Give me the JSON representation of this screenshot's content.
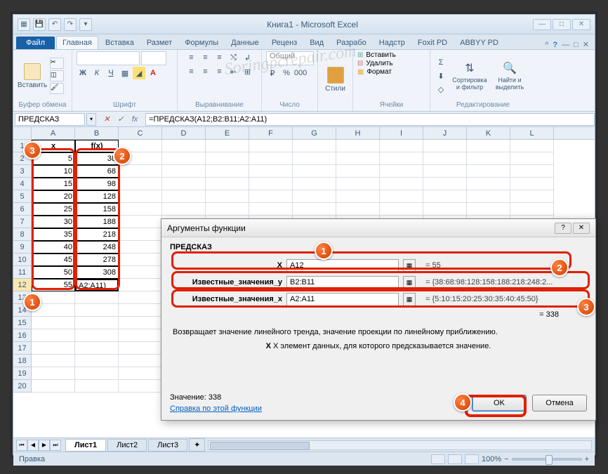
{
  "window": {
    "title": "Книга1 - Microsoft Excel"
  },
  "ribbon": {
    "file": "Файл",
    "tabs": [
      "Главная",
      "Вставка",
      "Размет",
      "Формулы",
      "Данные",
      "Реценз",
      "Вид",
      "Разрабо",
      "Надстр",
      "Foxit PD",
      "ABBYY PD"
    ],
    "groups": {
      "clipboard": "Буфер обмена",
      "paste": "Вставить",
      "font": "Шрифт",
      "alignment": "Выравнивание",
      "number": "Число",
      "number_format": "Общий",
      "styles": "Стили",
      "cells": "Ячейки",
      "insert": "Вставить",
      "delete": "Удалить",
      "format": "Формат",
      "editing": "Редактирование",
      "sort": "Сортировка и фильтр",
      "find": "Найти и выделить"
    }
  },
  "formula_bar": {
    "name_box": "ПРЕДСКАЗ",
    "formula": "=ПРЕДСКАЗ(A12;B2:B11;A2:A11)"
  },
  "columns": [
    "A",
    "B",
    "C",
    "D",
    "E",
    "F",
    "G",
    "H",
    "I",
    "J",
    "K",
    "L"
  ],
  "sheet": {
    "header_x": "x",
    "header_fx": "f(x)",
    "data": [
      {
        "x": "5",
        "fx": "38"
      },
      {
        "x": "10",
        "fx": "68"
      },
      {
        "x": "15",
        "fx": "98"
      },
      {
        "x": "20",
        "fx": "128"
      },
      {
        "x": "25",
        "fx": "158"
      },
      {
        "x": "30",
        "fx": "188"
      },
      {
        "x": "35",
        "fx": "218"
      },
      {
        "x": "40",
        "fx": "248"
      },
      {
        "x": "45",
        "fx": "278"
      },
      {
        "x": "50",
        "fx": "308"
      }
    ],
    "edit_row": {
      "x": "55",
      "fx": "A2:A11)"
    }
  },
  "sheet_tabs": [
    "Лист1",
    "Лист2",
    "Лист3"
  ],
  "status": {
    "mode": "Правка",
    "zoom": "100%"
  },
  "dialog": {
    "title": "Аргументы функции",
    "func": "ПРЕДСКАЗ",
    "args": [
      {
        "label": "X",
        "value": "A12",
        "result": "= 55"
      },
      {
        "label": "Известные_значения_y",
        "value": "B2:B11",
        "result": "= {38:68:98:128:158:188:218:248:2..."
      },
      {
        "label": "Известные_значения_x",
        "value": "A2:A11",
        "result": "= {5:10:15:20:25:30:35:40:45:50}"
      }
    ],
    "calc_result": "= 338",
    "description": "Возвращает значение линейного тренда, значение проекции по линейному приближению.",
    "sub_desc": "X элемент данных, для которого предсказывается значение.",
    "value_label": "Значение: 338",
    "help_link": "Справка по этой функции",
    "ok": "OK",
    "cancel": "Отмена"
  },
  "markers": {
    "m1": "1",
    "m2": "2",
    "m3": "3",
    "m4": "4"
  },
  "watermark": "Soringpcrepair.com"
}
